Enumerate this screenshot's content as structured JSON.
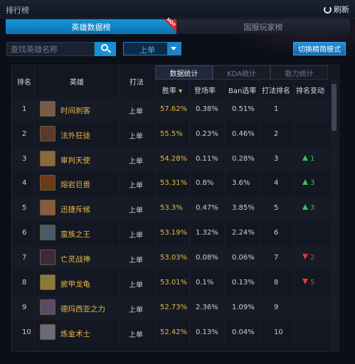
{
  "window": {
    "title": "排行榜",
    "refresh_label": "刷新"
  },
  "tabs": [
    {
      "label": "英雄数据榜",
      "active": true,
      "badge": "HOT"
    },
    {
      "label": "国服玩家榜",
      "active": false
    }
  ],
  "search": {
    "placeholder": "查找英雄名称"
  },
  "position_select": {
    "value": "上单"
  },
  "mode_button": {
    "label": "切换精简模式"
  },
  "subtabs": [
    "数据统计",
    "KDA统计",
    "能力统计"
  ],
  "columns": {
    "rank": "排名",
    "hero": "英雄",
    "role": "打法",
    "winrate": "胜率",
    "pickrate": "登场率",
    "banrate": "Ban选率",
    "role_rank": "打法排名",
    "rank_change": "排名变动"
  },
  "rows": [
    {
      "rank": "1",
      "name": "时间刺客",
      "role": "上单",
      "winrate": "57.62%",
      "pickrate": "0.38%",
      "banrate": "0.51%",
      "role_rank": "1",
      "change": "",
      "dir": ""
    },
    {
      "rank": "2",
      "name": "法外狂徒",
      "role": "上单",
      "winrate": "55.5%",
      "pickrate": "0.23%",
      "banrate": "0.46%",
      "role_rank": "2",
      "change": "",
      "dir": ""
    },
    {
      "rank": "3",
      "name": "审判天使",
      "role": "上单",
      "winrate": "54.28%",
      "pickrate": "0.11%",
      "banrate": "0.28%",
      "role_rank": "3",
      "change": "1",
      "dir": "up"
    },
    {
      "rank": "4",
      "name": "熔岩巨兽",
      "role": "上单",
      "winrate": "53.31%",
      "pickrate": "0.8%",
      "banrate": "3.6%",
      "role_rank": "4",
      "change": "3",
      "dir": "up"
    },
    {
      "rank": "5",
      "name": "迅捷斥候",
      "role": "上单",
      "winrate": "53.3%",
      "pickrate": "0.47%",
      "banrate": "3.85%",
      "role_rank": "5",
      "change": "3",
      "dir": "up"
    },
    {
      "rank": "6",
      "name": "蛮族之王",
      "role": "上单",
      "winrate": "53.19%",
      "pickrate": "1.32%",
      "banrate": "2.24%",
      "role_rank": "6",
      "change": "",
      "dir": ""
    },
    {
      "rank": "7",
      "name": "亡灵战神",
      "role": "上单",
      "winrate": "53.03%",
      "pickrate": "0.08%",
      "banrate": "0.06%",
      "role_rank": "7",
      "change": "2",
      "dir": "down"
    },
    {
      "rank": "8",
      "name": "披甲龙龟",
      "role": "上单",
      "winrate": "53.01%",
      "pickrate": "0.1%",
      "banrate": "0.13%",
      "role_rank": "8",
      "change": "5",
      "dir": "down"
    },
    {
      "rank": "9",
      "name": "德玛西亚之力",
      "role": "上单",
      "winrate": "52.73%",
      "pickrate": "2.36%",
      "banrate": "1.09%",
      "role_rank": "9",
      "change": "",
      "dir": ""
    },
    {
      "rank": "10",
      "name": "炼金术士",
      "role": "上单",
      "winrate": "52.42%",
      "pickrate": "0.13%",
      "banrate": "0.04%",
      "role_rank": "10",
      "change": "",
      "dir": ""
    }
  ],
  "colors": {
    "accent": "#1a8fd6",
    "hero_name": "#e8b64a",
    "rank_up": "#33c45a",
    "rank_down": "#e23a3a",
    "avatars": [
      "#7a5a4a",
      "#5a3a2a",
      "#8a6a3a",
      "#6a3a1a",
      "#8a5a3a",
      "#4a5a6a",
      "#3a2a3a",
      "#8a7a3a",
      "#5a4a6a",
      "#6a6a7a"
    ]
  }
}
